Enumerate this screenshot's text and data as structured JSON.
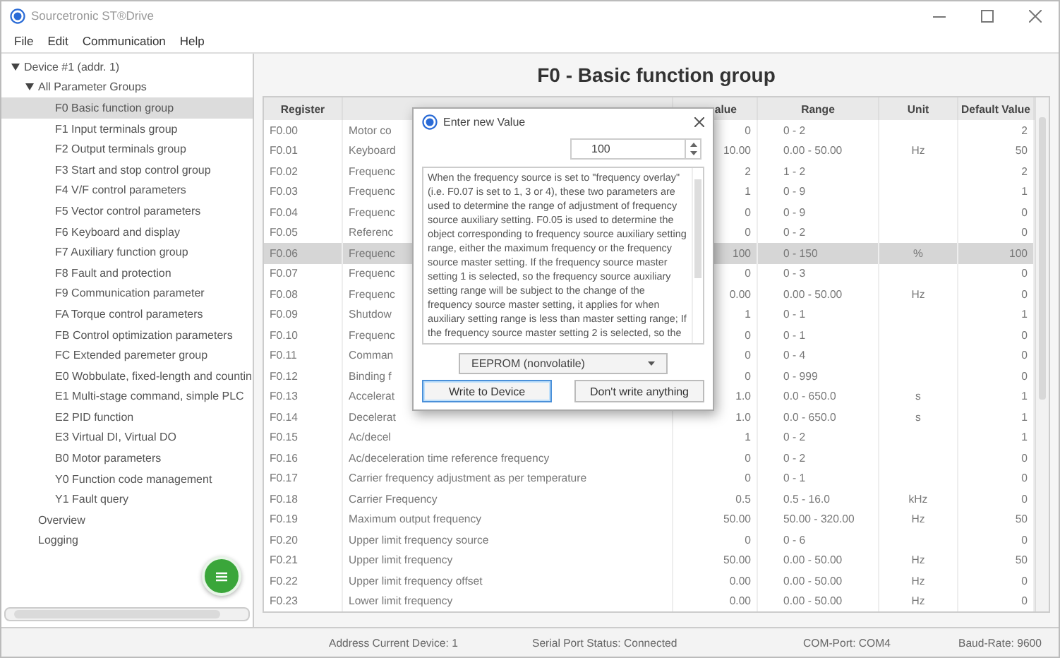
{
  "window": {
    "title": "Sourcetronic ST®Drive"
  },
  "menu": [
    "File",
    "Edit",
    "Communication",
    "Help"
  ],
  "tree": [
    {
      "label": "Device #1 (addr. 1)",
      "expanded": true,
      "selected": false,
      "children": [
        {
          "label": "All Parameter Groups",
          "expanded": true,
          "selected": false,
          "children": [
            {
              "label": "F0 Basic function group",
              "selected": true
            },
            {
              "label": "F1 Input terminals group",
              "selected": false
            },
            {
              "label": "F2 Output terminals group",
              "selected": false
            },
            {
              "label": "F3 Start and stop control group",
              "selected": false
            },
            {
              "label": "F4 V/F control parameters",
              "selected": false
            },
            {
              "label": "F5 Vector control parameters",
              "selected": false
            },
            {
              "label": "F6 Keyboard and display",
              "selected": false
            },
            {
              "label": "F7 Auxiliary function group",
              "selected": false
            },
            {
              "label": "F8 Fault and protection",
              "selected": false
            },
            {
              "label": "F9 Communication parameter",
              "selected": false
            },
            {
              "label": "FA Torque control parameters",
              "selected": false
            },
            {
              "label": "FB Control optimization parameters",
              "selected": false
            },
            {
              "label": "FC Extended paremeter group",
              "selected": false
            },
            {
              "label": "E0 Wobbulate, fixed-length and countin",
              "selected": false
            },
            {
              "label": "E1 Multi-stage command, simple PLC",
              "selected": false
            },
            {
              "label": "E2 PID function",
              "selected": false
            },
            {
              "label": "E3 Virtual DI, Virtual DO",
              "selected": false
            },
            {
              "label": "B0 Motor parameters",
              "selected": false
            },
            {
              "label": "Y0 Function code management",
              "selected": false
            },
            {
              "label": "Y1 Fault query",
              "selected": false
            }
          ]
        },
        {
          "label": "Overview",
          "selected": false
        },
        {
          "label": "Logging",
          "selected": false
        }
      ]
    }
  ],
  "heading": "F0 - Basic function group",
  "table": {
    "columns": {
      "register": "Register",
      "value": "alue",
      "range": "Range",
      "unit": "Unit",
      "default": "Default Value"
    },
    "rows": [
      {
        "register": "F0.00",
        "description": "Motor co",
        "value": "0",
        "range": "0 - 2",
        "default": "2",
        "selected": false
      },
      {
        "register": "F0.01",
        "description": "Keyboard",
        "value": "10.00",
        "range": "0.00 - 50.00",
        "unit": "Hz",
        "default": "50",
        "selected": false
      },
      {
        "register": "F0.02",
        "description": "Frequenc",
        "value": "2",
        "range": "1 - 2",
        "default": "2",
        "selected": false
      },
      {
        "register": "F0.03",
        "description": "Frequenc",
        "value": "1",
        "range": "0 - 9",
        "default": "1",
        "selected": false
      },
      {
        "register": "F0.04",
        "description": "Frequenc",
        "value": "0",
        "range": "0 - 9",
        "default": "0",
        "selected": false
      },
      {
        "register": "F0.05",
        "description": "Referenc",
        "value": "0",
        "range": "0 - 2",
        "default": "0",
        "selected": false
      },
      {
        "register": "F0.06",
        "description": "Frequenc",
        "value": "100",
        "range": "0 - 150",
        "unit": "%",
        "default": "100",
        "selected": true
      },
      {
        "register": "F0.07",
        "description": "Frequenc",
        "value": "0",
        "range": "0 - 3",
        "default": "0",
        "selected": false
      },
      {
        "register": "F0.08",
        "description": "Frequenc",
        "value": "0.00",
        "range": "0.00 - 50.00",
        "unit": "Hz",
        "default": "0",
        "selected": false
      },
      {
        "register": "F0.09",
        "description": "Shutdow",
        "value": "1",
        "range": "0 - 1",
        "default": "1",
        "selected": false
      },
      {
        "register": "F0.10",
        "description": "Frequenc",
        "value": "0",
        "range": "0 - 1",
        "default": "0",
        "selected": false
      },
      {
        "register": "F0.11",
        "description": "Comman",
        "value": "0",
        "range": "0 - 4",
        "default": "0",
        "selected": false
      },
      {
        "register": "F0.12",
        "description": "Binding f",
        "value": "0",
        "range": "0 - 999",
        "default": "0",
        "selected": false
      },
      {
        "register": "F0.13",
        "description": "Accelerat",
        "value": "1.0",
        "range": "0.0 - 650.0",
        "unit": "s",
        "default": "1",
        "selected": false
      },
      {
        "register": "F0.14",
        "description": "Decelerat",
        "value": "1.0",
        "range": "0.0 - 650.0",
        "unit": "s",
        "default": "1",
        "selected": false
      },
      {
        "register": "F0.15",
        "description": "Ac/decel",
        "value": "1",
        "range": "0 - 2",
        "default": "1",
        "selected": false
      },
      {
        "register": "F0.16",
        "description": "Ac/deceleration time reference frequency",
        "value": "0",
        "range": "0 - 2",
        "default": "0",
        "selected": false
      },
      {
        "register": "F0.17",
        "description": "Carrier frequency adjustment as per temperature",
        "value": "0",
        "range": "0 - 1",
        "default": "0",
        "selected": false
      },
      {
        "register": "F0.18",
        "description": "Carrier Frequency",
        "value": "0.5",
        "range": "0.5 - 16.0",
        "unit": "kHz",
        "default": "0",
        "selected": false
      },
      {
        "register": "F0.19",
        "description": "Maximum output frequency",
        "value": "50.00",
        "range": "50.00 - 320.00",
        "unit": "Hz",
        "default": "50",
        "selected": false
      },
      {
        "register": "F0.20",
        "description": "Upper limit frequency source",
        "value": "0",
        "range": "0 - 6",
        "default": "0",
        "selected": false
      },
      {
        "register": "F0.21",
        "description": "Upper limit frequency",
        "value": "50.00",
        "range": "0.00 - 50.00",
        "unit": "Hz",
        "default": "50",
        "selected": false
      },
      {
        "register": "F0.22",
        "description": "Upper limit frequency offset",
        "value": "0.00",
        "range": "0.00 - 50.00",
        "unit": "Hz",
        "default": "0",
        "selected": false
      },
      {
        "register": "F0.23",
        "description": "Lower limit frequency",
        "value": "0.00",
        "range": "0.00 - 50.00",
        "unit": "Hz",
        "default": "0",
        "selected": false
      }
    ]
  },
  "dialog": {
    "title": "Enter new Value",
    "value": "100",
    "description": "When the frequency source is set to \"frequency overlay\"(i.e. F0.07 is set to 1, 3 or 4), these two parameters are used to determine the range of adjustment of frequency source auxiliary setting. F0.05 is used to determine the object corresponding to frequency source auxiliary setting range, either the maximum frequency or the frequency source master setting. If the frequency source master setting 1 is selected, so the frequency source auxiliary setting range will be subject to the change of the frequency source master setting, it applies for when auxiliary setting range is less than master setting range; If the frequency source master setting 2 is selected, so the",
    "storage": "EEPROM (nonvolatile)",
    "buttons": [
      {
        "label": "Write to Device",
        "focused": true
      },
      {
        "label": "Don't write anything",
        "focused": false
      }
    ]
  },
  "status_bar": [
    "Address Current Device: 1",
    "Serial Port Status: Connected",
    "COM-Port: COM4",
    "Baud-Rate: 9600"
  ]
}
